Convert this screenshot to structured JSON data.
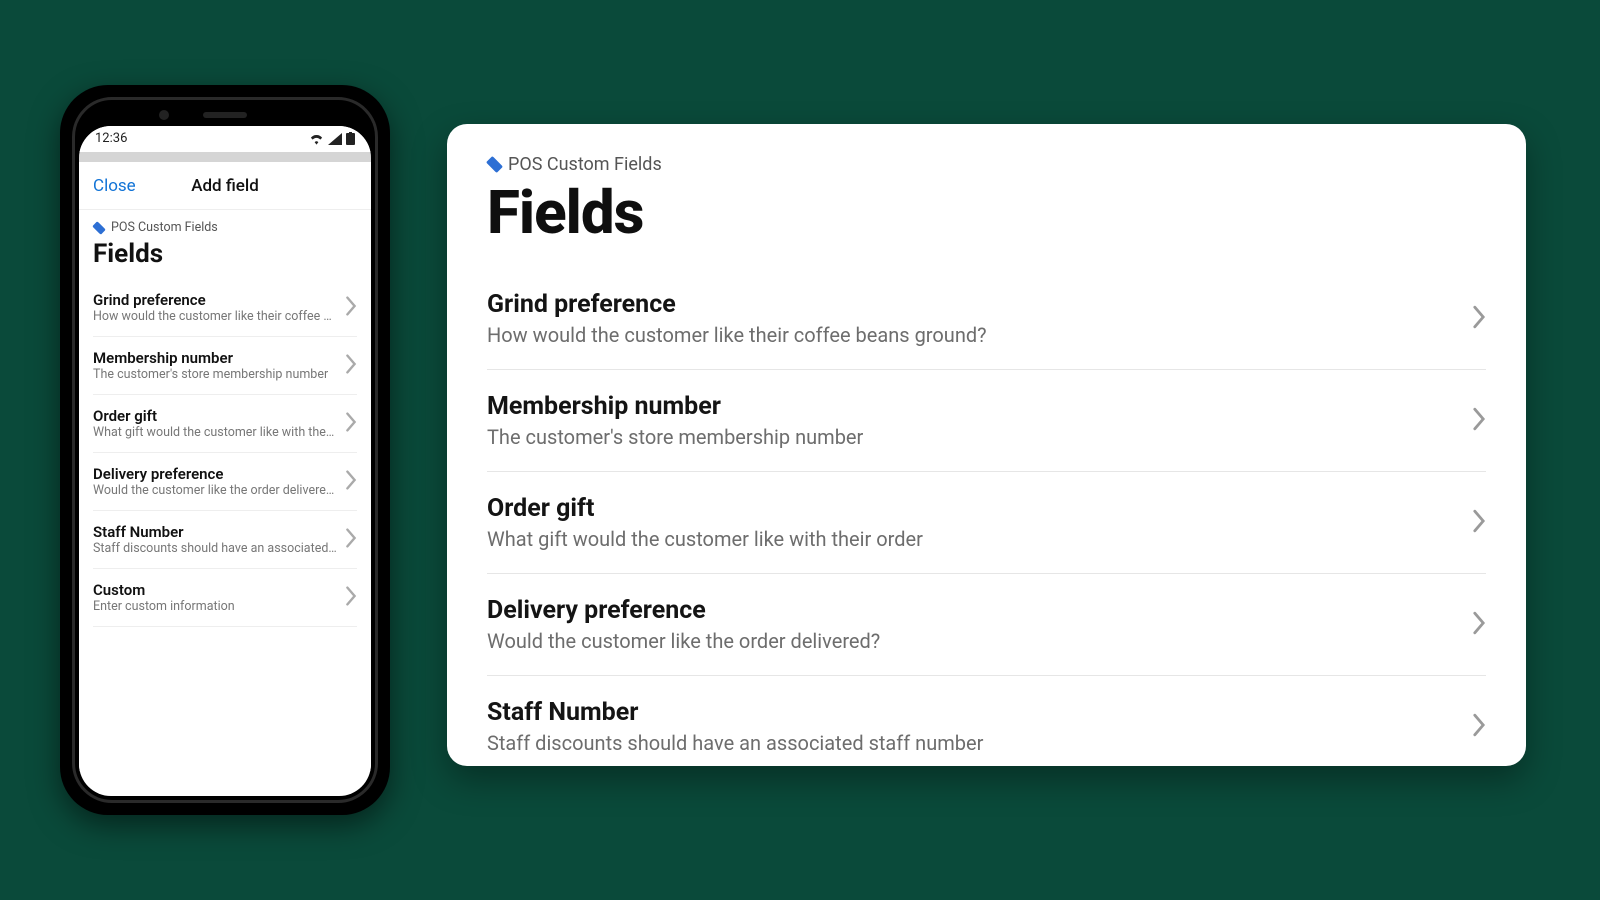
{
  "phone": {
    "status_time": "12:36",
    "header": {
      "close": "Close",
      "title": "Add field"
    },
    "breadcrumb": "POS Custom Fields",
    "heading": "Fields",
    "items": [
      {
        "title": "Grind preference",
        "desc": "How would the customer like their coffee bean…"
      },
      {
        "title": "Membership number",
        "desc": "The customer's store membership number"
      },
      {
        "title": "Order gift",
        "desc": "What gift would the customer like with their order"
      },
      {
        "title": "Delivery preference",
        "desc": "Would the customer like the order delivered?"
      },
      {
        "title": "Staff Number",
        "desc": "Staff discounts should have an associated sta…"
      },
      {
        "title": "Custom",
        "desc": "Enter custom information"
      }
    ]
  },
  "card": {
    "breadcrumb": "POS Custom Fields",
    "heading": "Fields",
    "items": [
      {
        "title": "Grind preference",
        "desc": "How would the customer like their coffee beans ground?"
      },
      {
        "title": "Membership number",
        "desc": "The customer's store membership number"
      },
      {
        "title": "Order gift",
        "desc": "What gift would the customer like with their order"
      },
      {
        "title": "Delivery preference",
        "desc": "Would the customer like the order delivered?"
      },
      {
        "title": "Staff Number",
        "desc": "Staff discounts should have an associated staff number"
      }
    ]
  }
}
